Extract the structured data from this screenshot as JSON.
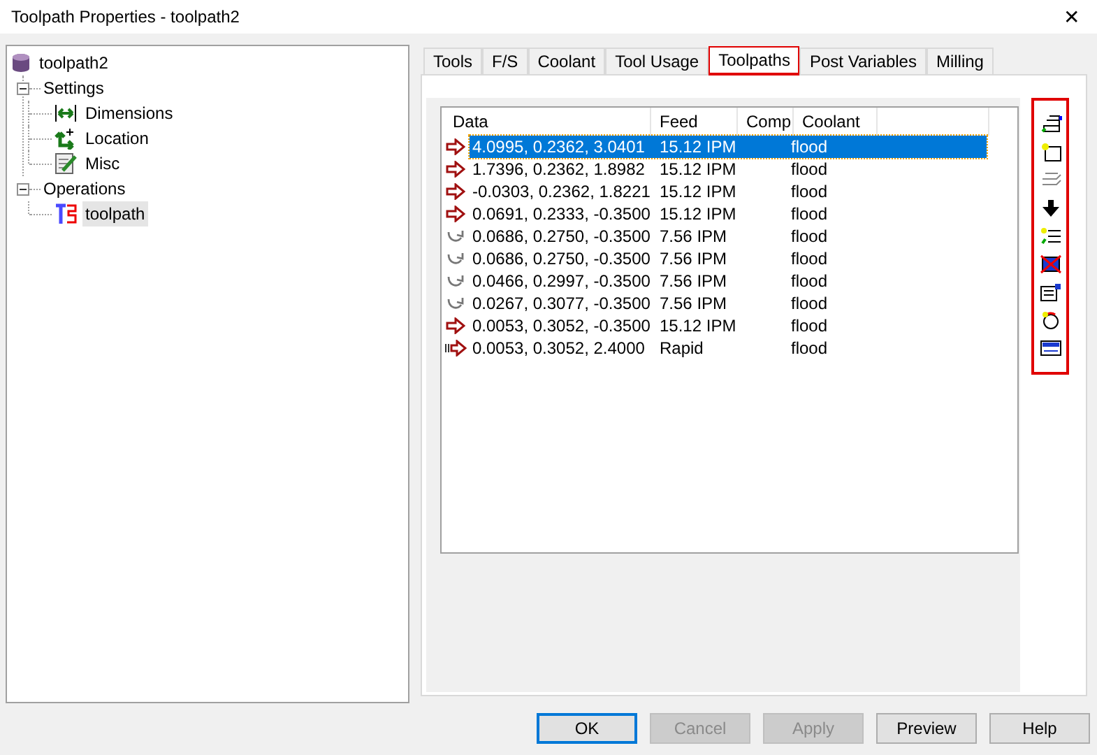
{
  "window": {
    "title": "Toolpath Properties - toolpath2",
    "close": "✕"
  },
  "tree": {
    "label": "toolpath2",
    "children": [
      {
        "label": "Settings",
        "expanded": true,
        "children": [
          {
            "label": "Dimensions",
            "kind": "dimensions"
          },
          {
            "label": "Location",
            "kind": "location"
          },
          {
            "label": "Misc",
            "kind": "misc"
          }
        ]
      },
      {
        "label": "Operations",
        "expanded": true,
        "children": [
          {
            "label": "toolpath",
            "kind": "toolpath",
            "selected": true
          }
        ]
      }
    ]
  },
  "tabs": [
    {
      "label": "Tools",
      "selected": false,
      "highlighted": false
    },
    {
      "label": "F/S",
      "selected": false,
      "highlighted": false
    },
    {
      "label": "Coolant",
      "selected": false,
      "highlighted": false
    },
    {
      "label": "Tool Usage",
      "selected": false,
      "highlighted": false
    },
    {
      "label": "Toolpaths",
      "selected": true,
      "highlighted": true
    },
    {
      "label": "Post Variables",
      "selected": false,
      "highlighted": false
    },
    {
      "label": "Milling",
      "selected": false,
      "highlighted": false
    }
  ],
  "table": {
    "columns": [
      "Data",
      "Feed",
      "Comp",
      "Coolant"
    ],
    "rows": [
      {
        "kind": "feed",
        "selected": true,
        "data": "4.0995, 0.2362, 3.0401",
        "feed": "15.12 IPM",
        "coolant": "flood"
      },
      {
        "kind": "feed",
        "selected": false,
        "data": "1.7396, 0.2362, 1.8982",
        "feed": "15.12 IPM",
        "coolant": "flood"
      },
      {
        "kind": "feed",
        "selected": false,
        "data": "-0.0303, 0.2362, 1.8221",
        "feed": "15.12 IPM",
        "coolant": "flood"
      },
      {
        "kind": "feed",
        "selected": false,
        "data": "0.0691, 0.2333, -0.3500",
        "feed": "15.12 IPM",
        "coolant": "flood"
      },
      {
        "kind": "arc",
        "selected": false,
        "data": "0.0686, 0.2750, -0.3500",
        "feed": "7.56 IPM",
        "coolant": "flood"
      },
      {
        "kind": "arc",
        "selected": false,
        "data": "0.0686, 0.2750, -0.3500",
        "feed": "7.56 IPM",
        "coolant": "flood"
      },
      {
        "kind": "arc",
        "selected": false,
        "data": "0.0466, 0.2997, -0.3500",
        "feed": "7.56 IPM",
        "coolant": "flood"
      },
      {
        "kind": "arc",
        "selected": false,
        "data": "0.0267, 0.3077, -0.3500",
        "feed": "7.56 IPM",
        "coolant": "flood"
      },
      {
        "kind": "feed",
        "selected": false,
        "data": "0.0053, 0.3052, -0.3500",
        "feed": "15.12 IPM",
        "coolant": "flood"
      },
      {
        "kind": "rapid",
        "selected": false,
        "data": "0.0053, 0.3052, 2.4000",
        "feed": "Rapid",
        "coolant": "flood"
      }
    ]
  },
  "toolbar": {
    "highlighted": true
  },
  "buttons": [
    {
      "label": "OK",
      "disabled": false,
      "default": true
    },
    {
      "label": "Cancel",
      "disabled": true,
      "default": false
    },
    {
      "label": "Apply",
      "disabled": true,
      "default": false
    },
    {
      "label": "Preview",
      "disabled": false,
      "default": false
    },
    {
      "label": "Help",
      "disabled": false,
      "default": false
    }
  ]
}
